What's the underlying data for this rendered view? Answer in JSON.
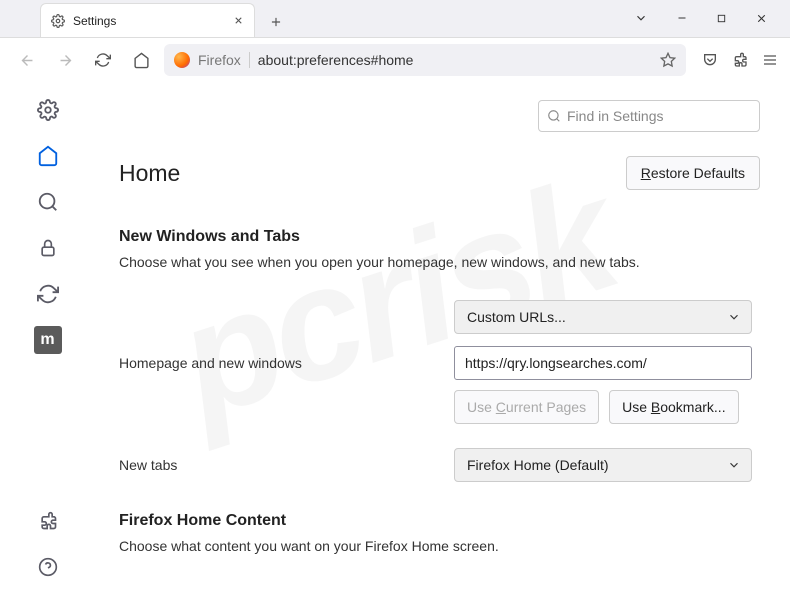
{
  "tab": {
    "title": "Settings"
  },
  "urlbar": {
    "brand": "Firefox",
    "url": "about:preferences#home"
  },
  "search": {
    "placeholder": "Find in Settings"
  },
  "page": {
    "title": "Home",
    "restore": "estore Defaults",
    "restore_accel": "R"
  },
  "section1": {
    "title": "New Windows and Tabs",
    "desc": "Choose what you see when you open your homepage, new windows, and new tabs."
  },
  "homepage": {
    "select": "Custom URLs...",
    "label": "Homepage and new windows",
    "value": "https://qry.longsearches.com/",
    "useCurrent": "urrent Pages",
    "useCurrent_pre": "Use ",
    "useCurrent_accel": "C",
    "useBookmark": "ookmark...",
    "useBookmark_pre": "Use ",
    "useBookmark_accel": "B"
  },
  "newtabs": {
    "label": "New tabs",
    "select": "Firefox Home (Default)"
  },
  "section2": {
    "title": "Firefox Home Content",
    "desc": "Choose what content you want on your Firefox Home screen."
  }
}
